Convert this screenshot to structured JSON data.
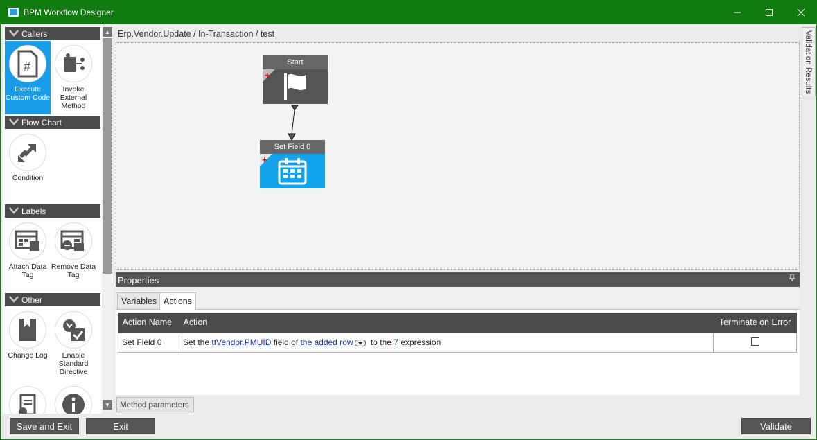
{
  "window": {
    "title": "BPM Workflow Designer"
  },
  "palette": {
    "sections": [
      {
        "label": "Callers",
        "tools": [
          {
            "label": "Execute Custom Code"
          },
          {
            "label": "Invoke External Method"
          }
        ]
      },
      {
        "label": "Flow Chart",
        "tools": [
          {
            "label": "Condition"
          }
        ]
      },
      {
        "label": "Labels",
        "tools": [
          {
            "label": "Attach Data Tag"
          },
          {
            "label": "Remove Data Tag"
          }
        ]
      },
      {
        "label": "Other",
        "tools": [
          {
            "label": "Change Log"
          },
          {
            "label": "Enable Standard Directive"
          }
        ]
      }
    ]
  },
  "breadcrumb": "Erp.Vendor.Update / In-Transaction / test",
  "canvas": {
    "nodes": [
      {
        "title": "Start",
        "icon": "flag-icon"
      },
      {
        "title": "Set Field 0",
        "icon": "calendar-grid-icon"
      }
    ]
  },
  "validation_tab": "Validation Results",
  "properties": {
    "title": "Properties",
    "tabs": [
      {
        "label": "Variables"
      },
      {
        "label": "Actions"
      }
    ],
    "columns": [
      "Action Name",
      "Action",
      "Terminate on Error"
    ],
    "rows": [
      {
        "name": "Set Field 0",
        "action": {
          "p1": "Set the ",
          "field": "ttVendor.PMUID",
          "p2": " field of ",
          "row": "the added row",
          "p3": " to the ",
          "expr": "7",
          "p4": " expression"
        },
        "terminate": false
      }
    ],
    "method_params_tab": "Method parameters"
  },
  "buttons": {
    "save_exit": "Save and Exit",
    "exit": "Exit",
    "validate": "Validate"
  },
  "colors": {
    "titlebar": "#107c10",
    "selected_tool": "#1a9de8",
    "header_dark": "#4a4a4a"
  }
}
